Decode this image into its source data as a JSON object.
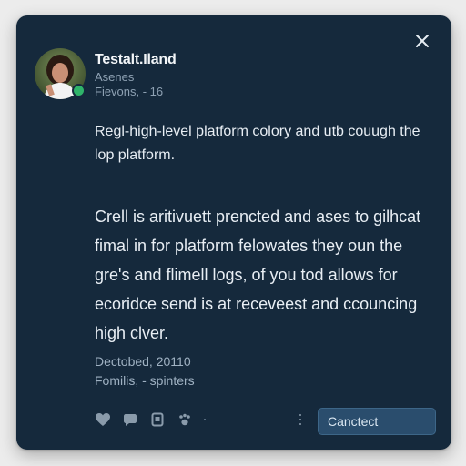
{
  "post": {
    "author_name": "Testalt.Iland",
    "author_subtitle_1": "Asenes",
    "author_subtitle_2": "Fievons, - 16",
    "intro_text": "Regl-high-level platform colory and utb couugh the lop platform.",
    "body_text": "Crell is aritivuett prencted and ases to gilhcat fimal in for platform felowates they oun the gre's and flimell logs, of you tod allows for ecoridce send is at receveest and ccouncing high clver.",
    "date": "Dectobed, 20110",
    "date_sub": "Fomilis, - spinters",
    "primary_button_label": "Canctect"
  },
  "icons": {
    "close": "close-icon",
    "like": "heart-icon",
    "comment": "comment-icon",
    "bookmark": "bookmark-icon",
    "react": "paw-icon",
    "more": "vertical-dots-icon"
  },
  "colors": {
    "card_background": "#15293c",
    "accent_button": "#2a4d6d",
    "online_status": "#2fb46a"
  }
}
